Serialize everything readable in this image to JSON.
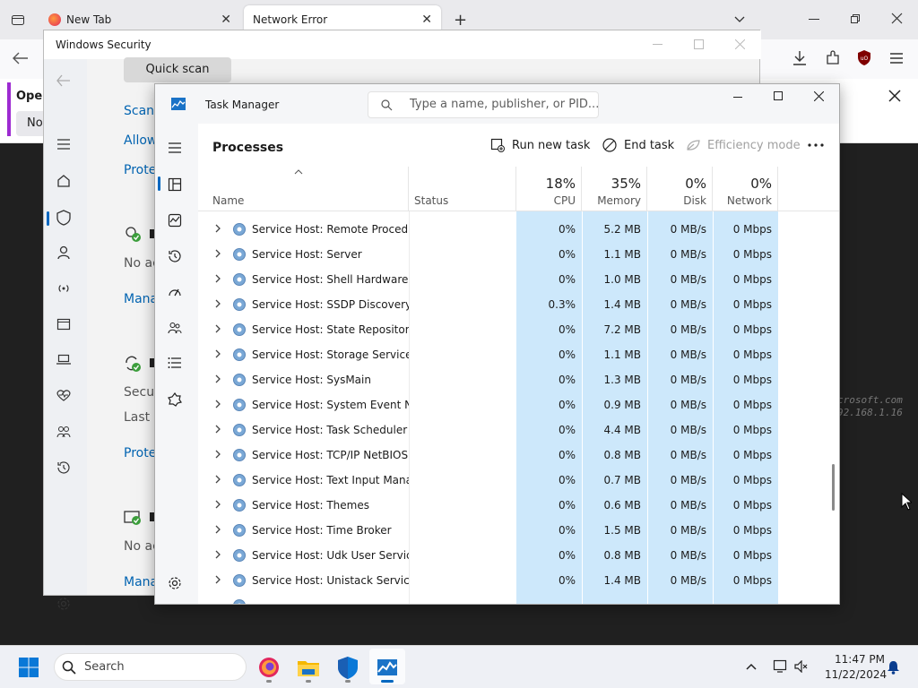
{
  "browser": {
    "tabs": [
      {
        "title": "New Tab"
      },
      {
        "title": "Network Error"
      }
    ],
    "infobar": {
      "line1": "Open",
      "line2": "Not"
    }
  },
  "windows_security": {
    "title": "Windows Security",
    "quick_scan": "Quick scan",
    "items": {
      "scan": "Scan o",
      "allow": "Allow",
      "protect1": "Prote",
      "no_action1": "No ac",
      "manage1": "Mana",
      "security": "Secur",
      "last": "Last u",
      "protect2": "Prote",
      "no_action2": "No ac",
      "manage2": "Mana"
    }
  },
  "task_manager": {
    "title": "Task Manager",
    "search_placeholder": "Type a name, publisher, or PID...",
    "page_title": "Processes",
    "commands": {
      "run_new_task": "Run new task",
      "end_task": "End task",
      "efficiency_mode": "Efficiency mode"
    },
    "columns": {
      "name": "Name",
      "status": "Status",
      "cpu_pct": "18%",
      "cpu": "CPU",
      "memory_pct": "35%",
      "memory": "Memory",
      "disk_pct": "0%",
      "disk": "Disk",
      "network_pct": "0%",
      "network": "Network"
    },
    "rows": [
      {
        "name": "Service Host: Remote Procedu...",
        "cpu": "0%",
        "memory": "5.2 MB",
        "disk": "0 MB/s",
        "network": "0 Mbps"
      },
      {
        "name": "Service Host: Server",
        "cpu": "0%",
        "memory": "1.1 MB",
        "disk": "0 MB/s",
        "network": "0 Mbps"
      },
      {
        "name": "Service Host: Shell Hardware ...",
        "cpu": "0%",
        "memory": "1.0 MB",
        "disk": "0 MB/s",
        "network": "0 Mbps"
      },
      {
        "name": "Service Host: SSDP Discovery",
        "cpu": "0.3%",
        "memory": "1.4 MB",
        "disk": "0 MB/s",
        "network": "0 Mbps"
      },
      {
        "name": "Service Host: State Repository ...",
        "cpu": "0%",
        "memory": "7.2 MB",
        "disk": "0 MB/s",
        "network": "0 Mbps"
      },
      {
        "name": "Service Host: Storage Service",
        "cpu": "0%",
        "memory": "1.1 MB",
        "disk": "0 MB/s",
        "network": "0 Mbps"
      },
      {
        "name": "Service Host: SysMain",
        "cpu": "0%",
        "memory": "1.3 MB",
        "disk": "0 MB/s",
        "network": "0 Mbps"
      },
      {
        "name": "Service Host: System Event No...",
        "cpu": "0%",
        "memory": "0.9 MB",
        "disk": "0 MB/s",
        "network": "0 Mbps"
      },
      {
        "name": "Service Host: Task Scheduler",
        "cpu": "0%",
        "memory": "4.4 MB",
        "disk": "0 MB/s",
        "network": "0 Mbps"
      },
      {
        "name": "Service Host: TCP/IP NetBIOS ...",
        "cpu": "0%",
        "memory": "0.8 MB",
        "disk": "0 MB/s",
        "network": "0 Mbps"
      },
      {
        "name": "Service Host: Text Input Mana...",
        "cpu": "0%",
        "memory": "0.7 MB",
        "disk": "0 MB/s",
        "network": "0 Mbps"
      },
      {
        "name": "Service Host: Themes",
        "cpu": "0%",
        "memory": "0.6 MB",
        "disk": "0 MB/s",
        "network": "0 Mbps"
      },
      {
        "name": "Service Host: Time Broker",
        "cpu": "0%",
        "memory": "1.5 MB",
        "disk": "0 MB/s",
        "network": "0 Mbps"
      },
      {
        "name": "Service Host: Udk User Service...",
        "cpu": "0%",
        "memory": "0.8 MB",
        "disk": "0 MB/s",
        "network": "0 Mbps"
      },
      {
        "name": "Service Host: Unistack Service ...",
        "cpu": "0%",
        "memory": "1.4 MB",
        "disk": "0 MB/s",
        "network": "0 Mbps"
      }
    ]
  },
  "background_text": {
    "line1": "crosoft.com",
    "line2": "92.168.1.16"
  },
  "taskbar": {
    "search_placeholder": "Search",
    "time": "11:47 PM",
    "date": "11/22/2024"
  },
  "colors": {
    "heatmap": "#cde8fb",
    "accent": "#0067c0",
    "link": "#0063b1"
  }
}
